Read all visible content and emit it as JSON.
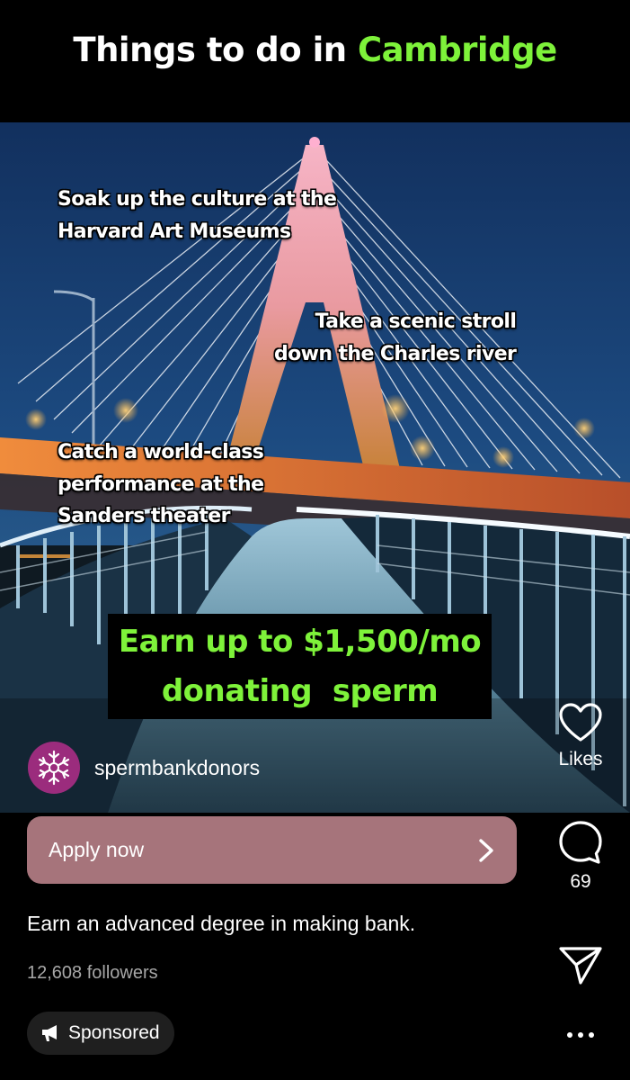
{
  "header": {
    "title_prefix": "Things to do in",
    "title_highlight": "Cambridge"
  },
  "captions": {
    "museums": [
      "Soak up the culture at the",
      "Harvard Art Museums"
    ],
    "river": [
      "Take a scenic stroll",
      "down the Charles river"
    ],
    "theater": [
      "Catch a world-class",
      "performance at the",
      "Sanders theater"
    ]
  },
  "promo": {
    "line1": "Earn up to $1,500/mo",
    "line2": "donating  sperm"
  },
  "account": {
    "name": "spermbankdonors",
    "avatar_color": "#9b2c7d"
  },
  "actions": {
    "likes_label": "Likes",
    "comments_count": "69",
    "like_icon": "heart-icon",
    "comment_icon": "comment-icon",
    "share_icon": "send-icon",
    "more_icon": "more-icon"
  },
  "cta": {
    "label": "Apply now",
    "color": "#a6747b"
  },
  "post": {
    "description": "Earn an advanced degree in making bank.",
    "followers": "12,608 followers",
    "sponsored_label": "Sponsored"
  },
  "colors": {
    "accent_green": "#7ef23a"
  }
}
